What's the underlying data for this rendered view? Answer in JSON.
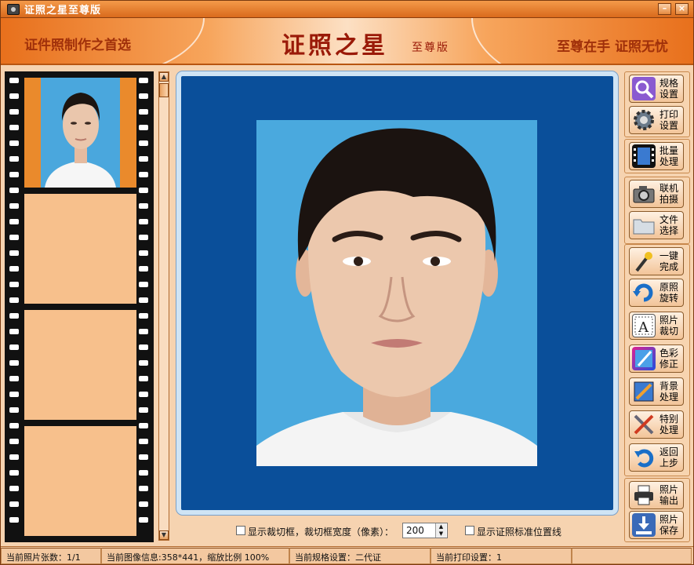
{
  "window": {
    "title": "证照之星至尊版",
    "minimize_label": "–",
    "close_label": "×"
  },
  "banner": {
    "slogan_left": "证件照制作之首选",
    "brand": "证照之星",
    "edition": "至尊版",
    "slogan_right": "至尊在手 证照无忧"
  },
  "filmstrip": {
    "frames": [
      {
        "state": "selected",
        "has_photo": true
      },
      {
        "state": "empty",
        "has_photo": false
      },
      {
        "state": "empty",
        "has_photo": false
      },
      {
        "state": "empty",
        "has_photo": false
      }
    ]
  },
  "options": {
    "show_crop_box_label": "显示裁切框，裁切框宽度（像素）：",
    "crop_width_value": "200",
    "show_guideline_label": "显示证照标准位置线"
  },
  "toolbar": {
    "buttons": [
      {
        "icon": "magnifier-icon",
        "label": "规格设置"
      },
      {
        "icon": "gear-icon",
        "label": "打印设置"
      },
      {
        "icon": "film-icon",
        "label": "批量处理"
      },
      {
        "icon": "camera-icon",
        "label": "联机拍摄"
      },
      {
        "icon": "folder-icon",
        "label": "文件选择"
      },
      {
        "icon": "magic-wand-icon",
        "label": "一键完成"
      },
      {
        "icon": "rotate-icon",
        "label": "原照旋转"
      },
      {
        "icon": "crop-icon",
        "label": "照片裁切"
      },
      {
        "icon": "color-brush-icon",
        "label": "色彩修正"
      },
      {
        "icon": "background-icon",
        "label": "背景处理"
      },
      {
        "icon": "tools-icon",
        "label": "特别处理"
      },
      {
        "icon": "undo-icon",
        "label": "返回上步"
      },
      {
        "icon": "printer-icon",
        "label": "照片输出"
      },
      {
        "icon": "save-icon",
        "label": "照片保存"
      }
    ]
  },
  "status": {
    "photo_count": "当前照片张数：1/1",
    "image_info": "当前图像信息:358*441，缩放比例 100%",
    "spec": "当前规格设置：二代证",
    "print_setting": "当前打印设置：1"
  },
  "colors": {
    "accent": "#e8701c",
    "preview_border_bg": "#0a4f9a",
    "photo_background": "#4aa9de"
  }
}
